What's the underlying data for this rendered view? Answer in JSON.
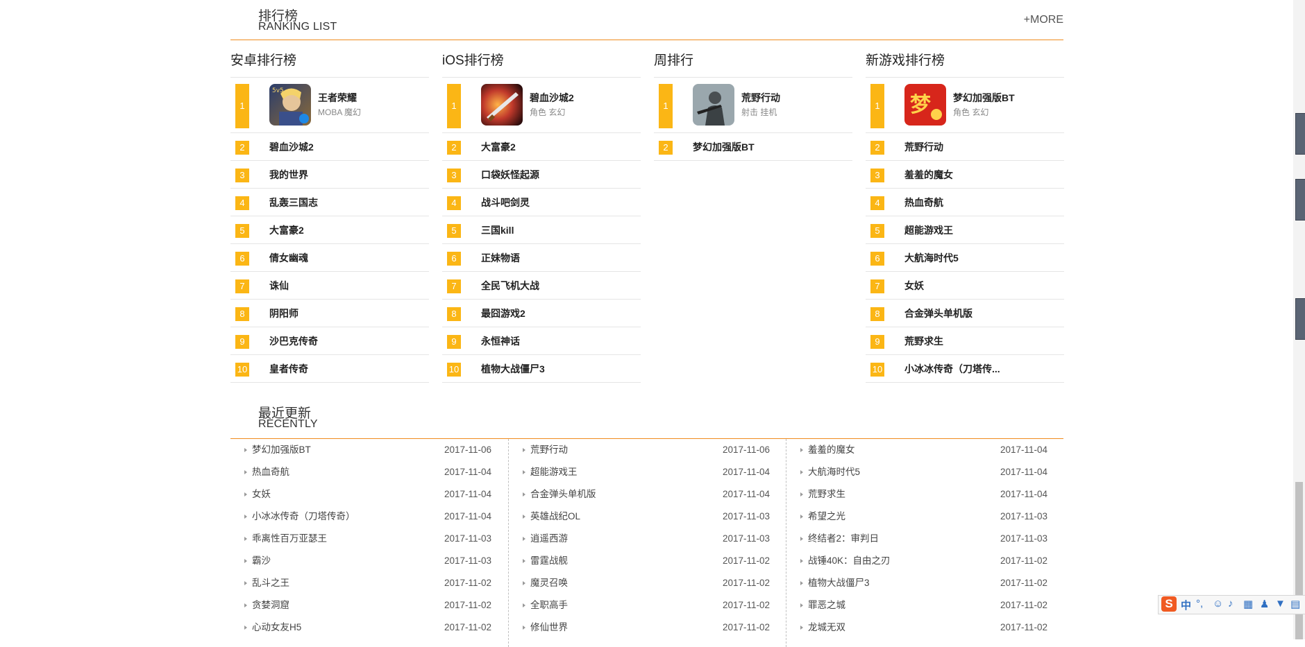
{
  "ranking": {
    "title_cn": "排行榜",
    "title_en": "RANKING LIST",
    "more": "+MORE",
    "columns": [
      {
        "title": "安卓排行榜",
        "top": {
          "num": "1",
          "name": "王者荣耀",
          "tags": "MOBA 魔幻",
          "icon": "honor-of-kings-icon"
        },
        "items": [
          {
            "num": "2",
            "name": "碧血沙城2"
          },
          {
            "num": "3",
            "name": "我的世界"
          },
          {
            "num": "4",
            "name": "乱轰三国志"
          },
          {
            "num": "5",
            "name": "大富豪2"
          },
          {
            "num": "6",
            "name": "倩女幽魂"
          },
          {
            "num": "7",
            "name": "诛仙"
          },
          {
            "num": "8",
            "name": "阴阳师"
          },
          {
            "num": "9",
            "name": "沙巴克传奇"
          },
          {
            "num": "10",
            "name": "皇者传奇"
          }
        ]
      },
      {
        "title": "iOS排行榜",
        "top": {
          "num": "1",
          "name": "碧血沙城2",
          "tags": "角色 玄幻",
          "icon": "sword-blade-icon"
        },
        "items": [
          {
            "num": "2",
            "name": "大富豪2"
          },
          {
            "num": "3",
            "name": "口袋妖怪起源"
          },
          {
            "num": "4",
            "name": "战斗吧剑灵"
          },
          {
            "num": "5",
            "name": "三国kill"
          },
          {
            "num": "6",
            "name": "正妹物语"
          },
          {
            "num": "7",
            "name": "全民飞机大战"
          },
          {
            "num": "8",
            "name": "最囧游戏2"
          },
          {
            "num": "9",
            "name": "永恒神话"
          },
          {
            "num": "10",
            "name": "植物大战僵尸3"
          }
        ]
      },
      {
        "title": "周排行",
        "top": {
          "num": "1",
          "name": "荒野行动",
          "tags": "射击 挂机",
          "icon": "soldier-icon"
        },
        "items": [
          {
            "num": "2",
            "name": "梦幻加强版BT"
          }
        ]
      },
      {
        "title": "新游戏排行榜",
        "top": {
          "num": "1",
          "name": "梦幻加强版BT",
          "tags": "角色 玄幻",
          "icon": "menghuan-logo-icon"
        },
        "items": [
          {
            "num": "2",
            "name": "荒野行动"
          },
          {
            "num": "3",
            "name": "羞羞的魔女"
          },
          {
            "num": "4",
            "name": "热血奇航"
          },
          {
            "num": "5",
            "name": "超能游戏王"
          },
          {
            "num": "6",
            "name": "大航海时代5"
          },
          {
            "num": "7",
            "name": "女妖"
          },
          {
            "num": "8",
            "name": "合金弹头单机版"
          },
          {
            "num": "9",
            "name": "荒野求生"
          },
          {
            "num": "10",
            "name": "小冰冰传奇（刀塔传..."
          }
        ]
      }
    ]
  },
  "recent": {
    "title_cn": "最近更新",
    "title_en": "RECENTLY",
    "columns": [
      [
        {
          "name": "梦幻加强版BT",
          "date": "2017-11-06"
        },
        {
          "name": "热血奇航",
          "date": "2017-11-04"
        },
        {
          "name": "女妖",
          "date": "2017-11-04"
        },
        {
          "name": "小冰冰传奇（刀塔传奇）",
          "date": "2017-11-04"
        },
        {
          "name": "乖离性百万亚瑟王",
          "date": "2017-11-03"
        },
        {
          "name": "霸沙",
          "date": "2017-11-03"
        },
        {
          "name": "乱斗之王",
          "date": "2017-11-02"
        },
        {
          "name": "贪婪洞窟",
          "date": "2017-11-02"
        },
        {
          "name": "心动女友H5",
          "date": "2017-11-02"
        }
      ],
      [
        {
          "name": "荒野行动",
          "date": "2017-11-06"
        },
        {
          "name": "超能游戏王",
          "date": "2017-11-04"
        },
        {
          "name": "合金弹头单机版",
          "date": "2017-11-04"
        },
        {
          "name": "英雄战纪OL",
          "date": "2017-11-03"
        },
        {
          "name": "逍遥西游",
          "date": "2017-11-03"
        },
        {
          "name": "雷霆战舰",
          "date": "2017-11-02"
        },
        {
          "name": "魔灵召唤",
          "date": "2017-11-02"
        },
        {
          "name": "全职高手",
          "date": "2017-11-02"
        },
        {
          "name": "修仙世界",
          "date": "2017-11-02"
        }
      ],
      [
        {
          "name": "羞羞的魔女",
          "date": "2017-11-04"
        },
        {
          "name": "大航海时代5",
          "date": "2017-11-04"
        },
        {
          "name": "荒野求生",
          "date": "2017-11-04"
        },
        {
          "name": "希望之光",
          "date": "2017-11-03"
        },
        {
          "name": "终结者2：审判日",
          "date": "2017-11-03"
        },
        {
          "name": "战锤40K：自由之刃",
          "date": "2017-11-02"
        },
        {
          "name": "植物大战僵尸3",
          "date": "2017-11-02"
        },
        {
          "name": "罪恶之城",
          "date": "2017-11-02"
        },
        {
          "name": "龙城无双",
          "date": "2017-11-02"
        }
      ]
    ]
  },
  "ime": {
    "logo": "S",
    "lang": "中",
    "icons": [
      "punctuation-icon",
      "emoji-icon",
      "microphone-icon",
      "keyboard-icon",
      "user-icon",
      "skin-icon",
      "toolbox-icon"
    ]
  },
  "colors": {
    "accent": "#f08a1c",
    "badge": "#fbb615"
  }
}
